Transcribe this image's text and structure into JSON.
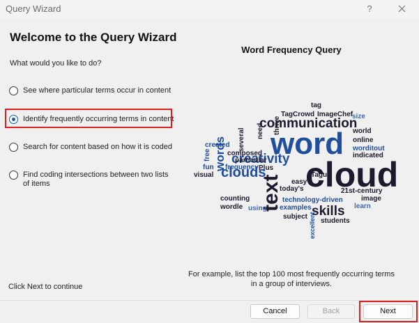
{
  "window": {
    "title": "Query Wizard",
    "help_label": "?"
  },
  "main": {
    "heading": "Welcome to the Query Wizard",
    "prompt": "What would you like to do?",
    "options": [
      {
        "label": "See where particular terms occur in content",
        "selected": false
      },
      {
        "label": "Identify frequently occurring terms in content",
        "selected": true
      },
      {
        "label": "Search for content based on how it is coded",
        "selected": false
      },
      {
        "label": "Find coding intersections between two lists of items",
        "selected": false
      }
    ],
    "hint": "Click Next to continue"
  },
  "preview": {
    "title": "Word Frequency Query",
    "cloud_words": [
      "word",
      "cloud",
      "communication",
      "creativity",
      "clouds",
      "text",
      "skills",
      "words",
      "tag",
      "TagCrowd",
      "ImageChef",
      "size",
      "world",
      "online",
      "worditout",
      "indicated",
      "21st-century",
      "image",
      "learn",
      "students",
      "subject",
      "examples",
      "technology-driven",
      "Tagul",
      "easy",
      "today's",
      "using",
      "wordle",
      "counting",
      "visual",
      "fun",
      "free",
      "frequency",
      "Plus",
      "particular",
      "composed",
      "created",
      "several",
      "need",
      "thrive",
      "excellent"
    ],
    "example_text": "For example, list the top 100 most frequently occurring terms in a group of interviews."
  },
  "footer": {
    "cancel": "Cancel",
    "back": "Back",
    "next": "Next"
  },
  "colors": {
    "cloud_dark": "#1e1a2e",
    "cloud_blue": "#1f4e9c",
    "cloud_mid": "#3c6bb5",
    "highlight": "#e01e1e",
    "radio_accent": "#0a5fb4"
  }
}
